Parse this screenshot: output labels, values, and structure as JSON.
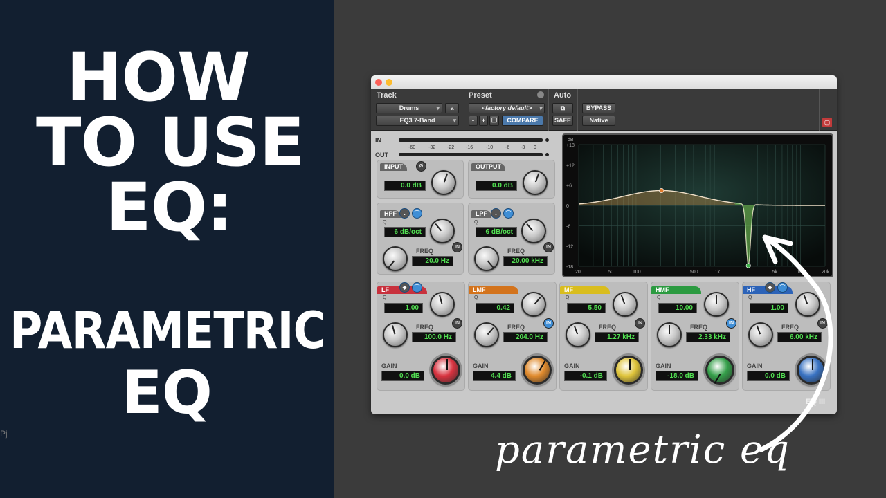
{
  "title": {
    "line1": "HOW",
    "line2": "TO USE",
    "line3": "EQ:",
    "line4": "PARAMETRIC",
    "line5": "EQ",
    "small": "Pj"
  },
  "annotation": "parametric eq",
  "plugin": {
    "header": {
      "track_label": "Track",
      "preset_label": "Preset",
      "auto_label": "Auto",
      "track_value": "Drums",
      "track_letter": "a",
      "insert_value": "EQ3 7-Band",
      "preset_value": "<factory default>",
      "minus": "-",
      "plus": "+",
      "compare": "COMPARE",
      "safe": "SAFE",
      "bypass": "BYPASS",
      "native": "Native"
    },
    "meters": {
      "in_label": "IN",
      "out_label": "OUT",
      "ticks": [
        "-60",
        "-32",
        "-22",
        "-16",
        "-10",
        "-6",
        "-3",
        "0"
      ]
    },
    "input": {
      "label": "INPUT",
      "value": "0.0 dB",
      "phase": "Ø"
    },
    "output": {
      "label": "OUTPUT",
      "value": "0.0 dB"
    },
    "hpf": {
      "label": "HPF",
      "q_label": "Q",
      "slope": "6 dB/oct",
      "freq_label": "FREQ",
      "freq": "20.0 Hz",
      "in": "IN"
    },
    "lpf": {
      "label": "LPF",
      "q_label": "Q",
      "slope": "6 dB/oct",
      "freq_label": "FREQ",
      "freq": "20.00 kHz",
      "in": "IN"
    },
    "bands": [
      {
        "label": "LF",
        "q_label": "Q",
        "q": "1.00",
        "freq_label": "FREQ",
        "freq": "100.0 Hz",
        "gain_label": "GAIN",
        "gain": "0.0 dB",
        "in": "IN",
        "color": "#c8313d",
        "knob": "#d8323f"
      },
      {
        "label": "LMF",
        "q_label": "Q",
        "q": "0.42",
        "freq_label": "FREQ",
        "freq": "204.0 Hz",
        "gain_label": "GAIN",
        "gain": "4.4 dB",
        "in": "IN",
        "color": "#d3731c",
        "knob": "#e08a2c"
      },
      {
        "label": "MF",
        "q_label": "Q",
        "q": "5.50",
        "freq_label": "FREQ",
        "freq": "1.27 kHz",
        "gain_label": "GAIN",
        "gain": "-0.1 dB",
        "in": "IN",
        "color": "#d9bd1e",
        "knob": "#dfc43a"
      },
      {
        "label": "HMF",
        "q_label": "Q",
        "q": "10.00",
        "freq_label": "FREQ",
        "freq": "2.33 kHz",
        "gain_label": "GAIN",
        "gain": "-18.0 dB",
        "in": "IN",
        "color": "#2b9a40",
        "knob": "#35a04a"
      },
      {
        "label": "HF",
        "q_label": "Q",
        "q": "1.00",
        "freq_label": "FREQ",
        "freq": "6.00 kHz",
        "gain_label": "GAIN",
        "gain": "0.0 dB",
        "in": "IN",
        "color": "#2c63b8",
        "knob": "#3872c2"
      }
    ],
    "graph": {
      "db_label": "dB",
      "db_ticks": [
        "+18",
        "+12",
        "+6",
        "0",
        "-6",
        "-12",
        "-18"
      ],
      "freq_ticks": [
        "20",
        "50",
        "100",
        "500",
        "1k",
        "5k",
        "10k",
        "20k"
      ],
      "curve_color": "#e0a050",
      "cut_color": "#3fb24a"
    },
    "logo": "EQ III"
  }
}
